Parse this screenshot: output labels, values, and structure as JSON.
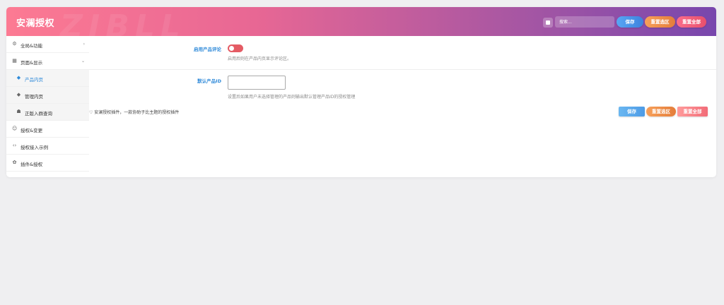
{
  "header": {
    "title": "安澜授权",
    "watermark": "ZIBLL",
    "search": {
      "placeholder": "搜索..."
    },
    "buttons": {
      "save": "保存",
      "reset_section": "重置选区",
      "reset_all": "重置全部"
    }
  },
  "sidebar": {
    "items": [
      {
        "label": "全局&功能",
        "icon": "gear-icon",
        "chevron": "›"
      },
      {
        "label": "页面&显示",
        "icon": "calendar-icon",
        "chevron": "⌄"
      },
      {
        "label": "产品内页",
        "icon": "cube-icon"
      },
      {
        "label": "管理内页",
        "icon": "cube-icon"
      },
      {
        "label": "正版入群查询",
        "icon": "users-icon"
      },
      {
        "label": "授权&变更",
        "icon": "smile-icon"
      },
      {
        "label": "授权接入示例",
        "icon": "code-icon"
      },
      {
        "label": "插件&授权",
        "icon": "puzzle-icon"
      }
    ]
  },
  "main": {
    "review_toggle": {
      "label": "启用产品评论",
      "help": "启用后则在产品内页显示评论区。",
      "enabled": true
    },
    "default_product": {
      "label": "默认产品ID",
      "value": "",
      "help": "设置后如果用户未选择管理的产品则输出默认管理产品ID的授权管理"
    }
  },
  "footer": {
    "note": "♡ 安澜授权插件，一款协助子比主题的授权插件",
    "buttons": {
      "save": "保存",
      "reset_section": "重置选区",
      "reset_all": "重置全部"
    }
  },
  "colors": {
    "accent": "#2f8ad9",
    "toggle": "#e45b64",
    "header_start": "#fc7a93",
    "header_end": "#7847ad"
  }
}
